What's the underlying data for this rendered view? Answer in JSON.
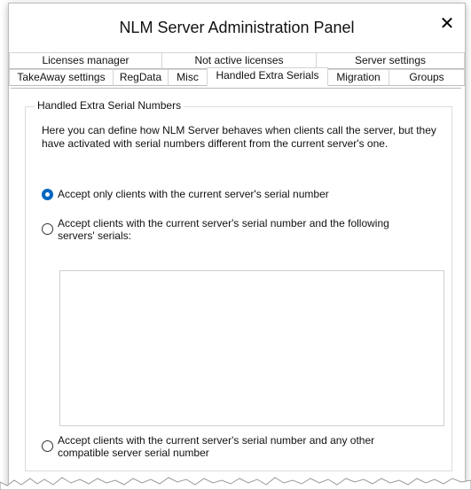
{
  "window": {
    "title": "NLM Server Administration Panel",
    "close_glyph": "✕",
    "close_icon": "close-icon"
  },
  "tabs": {
    "row1": [
      {
        "label": "Licenses manager"
      },
      {
        "label": "Not active licenses"
      },
      {
        "label": "Server settings"
      }
    ],
    "row2": [
      {
        "label": "TakeAway settings"
      },
      {
        "label": "RegData"
      },
      {
        "label": "Misc"
      },
      {
        "label": "Handled Extra Serials",
        "active": true
      },
      {
        "label": "Migration"
      },
      {
        "label": "Groups"
      }
    ]
  },
  "panel": {
    "group_title": "Handled Extra Serial Numbers",
    "description": "Here you can define how NLM Server behaves when clients call the server, but they have activated with serial numbers different from the current server's one.",
    "options": [
      {
        "label": "Accept only clients with the current server's serial number",
        "checked": true
      },
      {
        "label": "Accept clients with the current server's serial number and the following servers' serials:",
        "checked": false
      },
      {
        "label": "Accept clients with the current server's serial number and any other compatible server serial number",
        "checked": false
      }
    ],
    "serials_list_items": []
  },
  "colors": {
    "accent": "#0067c0",
    "border": "#bcbcbc"
  }
}
